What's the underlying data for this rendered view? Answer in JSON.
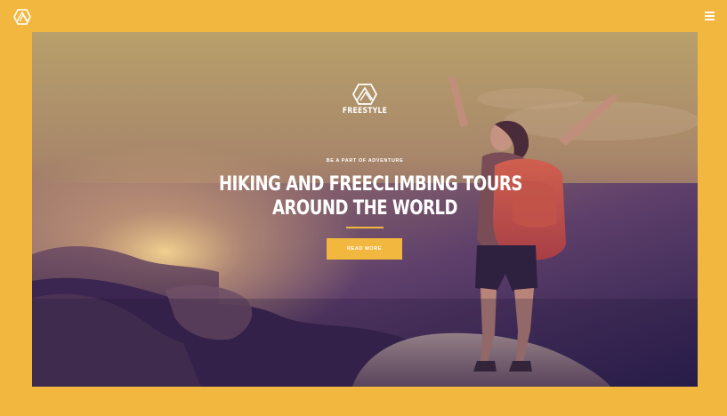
{
  "colors": {
    "accent": "#F2B73F",
    "text": "#FFFFFF"
  },
  "header": {
    "logo_icon": "freestyle-logo-icon",
    "menu_icon": "hamburger-menu-icon"
  },
  "hero": {
    "brand_name": "FREESTYLE",
    "tagline": "BE A PART OF ADVENTURE",
    "headline_line1": "HIKING AND FREECLIMBING TOURS",
    "headline_line2": "AROUND THE WORLD",
    "button_label": "READ MORE"
  }
}
